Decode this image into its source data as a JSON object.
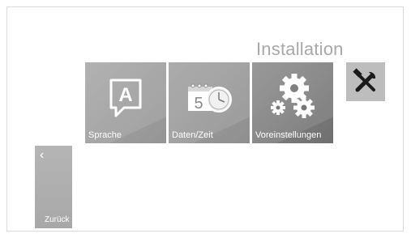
{
  "screen": {
    "title": "Installation"
  },
  "tiles": [
    {
      "label": "Sprache",
      "icon": "language-letter-icon",
      "icon_text": "A"
    },
    {
      "label": "Daten/Zeit",
      "icon": "calendar-clock-icon",
      "icon_text": "5"
    },
    {
      "label": "Voreinstellungen",
      "icon": "gears-icon"
    }
  ],
  "tools_button": {
    "icon": "tools-icon"
  },
  "back_button": {
    "label": "Zurück",
    "icon": "chevron-left-icon",
    "glyph": "‹"
  },
  "colors": {
    "tile_gray": "#9f9f9f",
    "tile_dark": "#7c7c7c",
    "title_gray": "#a8a8a8",
    "tools_bg": "#bdbdbd"
  }
}
